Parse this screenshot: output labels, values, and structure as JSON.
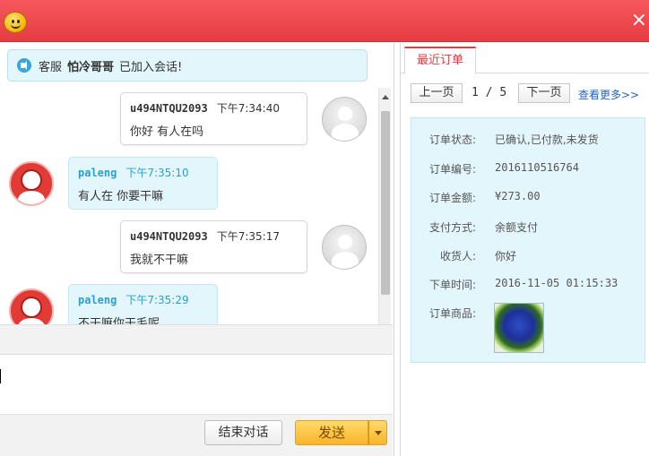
{
  "titlebar": {
    "close_glyph": "×"
  },
  "notice": {
    "prefix": "客服",
    "agent_name": "怕冷哥哥",
    "suffix": "已加入会话!"
  },
  "messages": [
    {
      "from": "customer",
      "name": "u494NTQU2093",
      "time": "下午7:34:40",
      "text": "你好 有人在吗"
    },
    {
      "from": "agent",
      "name": "paleng",
      "time": "下午7:35:10",
      "text": "有人在 你要干嘛"
    },
    {
      "from": "customer",
      "name": "u494NTQU2093",
      "time": "下午7:35:17",
      "text": "我就不干嘛"
    },
    {
      "from": "agent",
      "name": "paleng",
      "time": "下午7:35:29",
      "text": "不干嘛你干毛呢"
    }
  ],
  "input": {
    "value": ""
  },
  "buttons": {
    "end_chat": "结束对话",
    "send": "发送"
  },
  "order_panel": {
    "tab_label": "最近订单",
    "pager": {
      "prev": "上一页",
      "current": "1",
      "separator": "/",
      "total": "5",
      "next": "下一页",
      "more": "查看更多>>"
    },
    "fields": [
      {
        "label": "订单状态:",
        "value": "已确认,已付款,未发货"
      },
      {
        "label": "订单编号:",
        "value": "2016110516764"
      },
      {
        "label": "订单金额:",
        "value": "¥273.00"
      },
      {
        "label": "支付方式:",
        "value": "余额支付"
      },
      {
        "label": "收货人:",
        "value": "你好"
      },
      {
        "label": "下单时间:",
        "value": "2016-11-05 01:15:33"
      },
      {
        "label": "订单商品:",
        "value": ""
      }
    ],
    "product_image": "blue-rose-bouquet"
  },
  "colors": {
    "title_red": "#e63c42",
    "agent_blue": "#2b9fd1",
    "send_orange": "#f8b52a",
    "link_blue": "#2362c4"
  }
}
